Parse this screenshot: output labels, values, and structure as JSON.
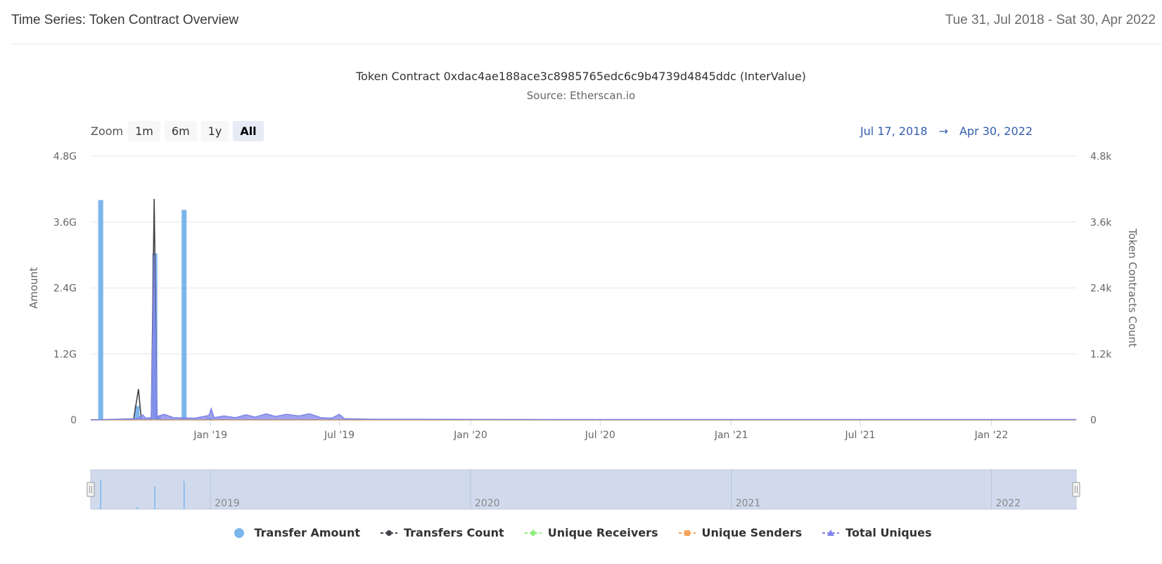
{
  "header": {
    "title": "Time Series: Token Contract Overview",
    "date_range": "Tue 31, Jul 2018 - Sat 30, Apr 2022"
  },
  "zoom": {
    "label": "Zoom",
    "buttons": [
      "1m",
      "6m",
      "1y",
      "All"
    ],
    "active": "All"
  },
  "range_selector": {
    "from": "Jul 17, 2018",
    "arrow": "→",
    "to": "Apr 30, 2022"
  },
  "chart_data": {
    "type": "bar",
    "title": "Token Contract 0xdac4ae188ace3c8985765edc6c9b4739d4845ddc (InterValue)",
    "subtitle": "Source: Etherscan.io",
    "x_range": [
      "2018-07-17",
      "2022-04-30"
    ],
    "x_ticks": [
      {
        "date": "2019-01-01",
        "label": "Jan '19"
      },
      {
        "date": "2019-07-01",
        "label": "Jul '19"
      },
      {
        "date": "2020-01-01",
        "label": "Jan '20"
      },
      {
        "date": "2020-07-01",
        "label": "Jul '20"
      },
      {
        "date": "2021-01-01",
        "label": "Jan '21"
      },
      {
        "date": "2021-07-01",
        "label": "Jul '21"
      },
      {
        "date": "2022-01-01",
        "label": "Jan '22"
      }
    ],
    "y_left": {
      "label": "Amount",
      "range": [
        0,
        4800000000
      ],
      "ticks": [
        "0",
        "1.2G",
        "2.4G",
        "3.6G",
        "4.8G"
      ]
    },
    "y_right": {
      "label": "Token Contracts Count",
      "range": [
        0,
        4800
      ],
      "ticks": [
        "0",
        "1.2k",
        "2.4k",
        "3.6k",
        "4.8k"
      ]
    },
    "grid": true,
    "legend_position": "bottom",
    "series": [
      {
        "name": "Transfer Amount",
        "axis": "left",
        "color": "#7cb5ec",
        "kind": "column",
        "points": [
          [
            "2018-07-31",
            4000000000
          ],
          [
            "2018-09-20",
            250000000
          ],
          [
            "2018-10-15",
            3030000000
          ],
          [
            "2018-11-25",
            3820000000
          ],
          [
            "2018-10-20",
            80000000
          ],
          [
            "2018-12-30",
            40000000
          ]
        ]
      },
      {
        "name": "Transfers Count",
        "axis": "right",
        "color": "#434348",
        "kind": "line",
        "points": [
          [
            "2018-07-17",
            0
          ],
          [
            "2018-09-15",
            0
          ],
          [
            "2018-09-22",
            560
          ],
          [
            "2018-09-26",
            0
          ],
          [
            "2018-10-10",
            0
          ],
          [
            "2018-10-14",
            4020
          ],
          [
            "2018-10-18",
            0
          ],
          [
            "2018-11-20",
            0
          ],
          [
            "2019-01-01",
            0
          ],
          [
            "2022-04-30",
            0
          ]
        ]
      },
      {
        "name": "Unique Receivers",
        "axis": "right",
        "color": "#90ed7d",
        "kind": "line",
        "points": [
          [
            "2018-07-17",
            0
          ],
          [
            "2022-04-30",
            0
          ]
        ]
      },
      {
        "name": "Unique Senders",
        "axis": "right",
        "color": "#f7a35c",
        "kind": "line",
        "points": [
          [
            "2018-07-17",
            0
          ],
          [
            "2022-04-30",
            0
          ]
        ]
      },
      {
        "name": "Total Uniques",
        "axis": "right",
        "color": "#8085e9",
        "kind": "area",
        "points": [
          [
            "2018-07-17",
            0
          ],
          [
            "2018-09-20",
            20
          ],
          [
            "2018-09-28",
            90
          ],
          [
            "2018-10-02",
            30
          ],
          [
            "2018-10-10",
            40
          ],
          [
            "2018-10-14",
            3000
          ],
          [
            "2018-10-18",
            60
          ],
          [
            "2018-10-28",
            100
          ],
          [
            "2018-11-10",
            40
          ],
          [
            "2018-12-10",
            30
          ],
          [
            "2018-12-30",
            80
          ],
          [
            "2019-01-02",
            200
          ],
          [
            "2019-01-06",
            40
          ],
          [
            "2019-01-20",
            70
          ],
          [
            "2019-02-05",
            40
          ],
          [
            "2019-02-20",
            90
          ],
          [
            "2019-03-05",
            50
          ],
          [
            "2019-03-20",
            110
          ],
          [
            "2019-04-02",
            60
          ],
          [
            "2019-04-18",
            100
          ],
          [
            "2019-05-05",
            70
          ],
          [
            "2019-05-20",
            110
          ],
          [
            "2019-06-05",
            40
          ],
          [
            "2019-06-20",
            30
          ],
          [
            "2019-07-01",
            100
          ],
          [
            "2019-07-08",
            20
          ],
          [
            "2019-08-15",
            10
          ],
          [
            "2019-10-01",
            10
          ],
          [
            "2020-06-01",
            5
          ],
          [
            "2022-04-30",
            5
          ]
        ]
      }
    ]
  },
  "navigator": {
    "labels": [
      "2019",
      "2020",
      "2021",
      "2022"
    ]
  },
  "legend": [
    {
      "label": "Transfer Amount",
      "color": "#7cb5ec",
      "symbol": "circle"
    },
    {
      "label": "Transfers Count",
      "color": "#434348",
      "symbol": "circle-line"
    },
    {
      "label": "Unique Receivers",
      "color": "#90ed7d",
      "symbol": "diamond-line"
    },
    {
      "label": "Unique Senders",
      "color": "#f7a35c",
      "symbol": "square-line"
    },
    {
      "label": "Total Uniques",
      "color": "#8085e9",
      "symbol": "triangle-line"
    }
  ]
}
